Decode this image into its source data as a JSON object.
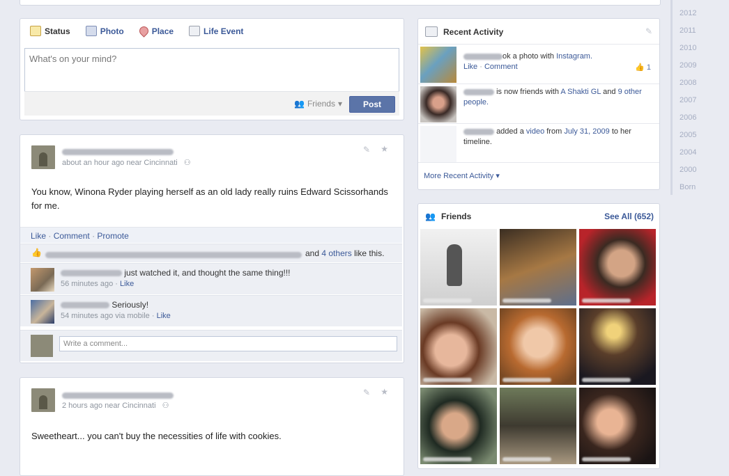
{
  "composer": {
    "tabs": [
      {
        "label": "Status",
        "icon": "status-icon"
      },
      {
        "label": "Photo",
        "icon": "photo-icon"
      },
      {
        "label": "Place",
        "icon": "place-pin-icon"
      },
      {
        "label": "Life Event",
        "icon": "life-event-icon"
      }
    ],
    "placeholder": "What's on your mind?",
    "audience": "Friends",
    "post_label": "Post"
  },
  "posts": [
    {
      "meta": "about an hour ago near Cincinnati",
      "text": "You know, Winona Ryder playing herself as an old lady really ruins Edward Scissorhands for me.",
      "actions": [
        "Like",
        "Comment",
        "Promote"
      ],
      "likes_and": "and",
      "likes_others": "4 others",
      "likes_suffix": "like this.",
      "comments": [
        {
          "text": "just watched it, and thought the same thing!!!",
          "time": "56 minutes ago",
          "like": "Like"
        },
        {
          "text": "Seriously!",
          "time": "54 minutes ago via mobile",
          "like": "Like"
        }
      ],
      "write_placeholder": "Write a comment..."
    },
    {
      "meta": "2 hours ago near Cincinnati",
      "text": "Sweetheart... you can't buy the necessities of life with cookies."
    }
  ],
  "recent": {
    "title": "Recent Activity",
    "items": [
      {
        "pre": "ok a photo with",
        "link": "Instagram.",
        "actions": [
          "Like",
          "Comment"
        ],
        "like_count": "1"
      },
      {
        "pre": "is now friends with",
        "link1": "A Shakti GL",
        "mid": "and",
        "link2": "9 other people."
      },
      {
        "pre": "added a",
        "link1": "video",
        "mid": "from",
        "link2": "July 31, 2009",
        "post": "to her timeline."
      }
    ],
    "more": "More Recent Activity"
  },
  "friends": {
    "title": "Friends",
    "see_all": "See All (652)"
  },
  "years": [
    "2012",
    "2011",
    "2010",
    "2009",
    "2008",
    "2007",
    "2006",
    "2005",
    "2004",
    "2000",
    "Born"
  ],
  "colors": {
    "link": "#3b5998",
    "post_button": "#5b74a8",
    "background": "#e9ebf2"
  }
}
